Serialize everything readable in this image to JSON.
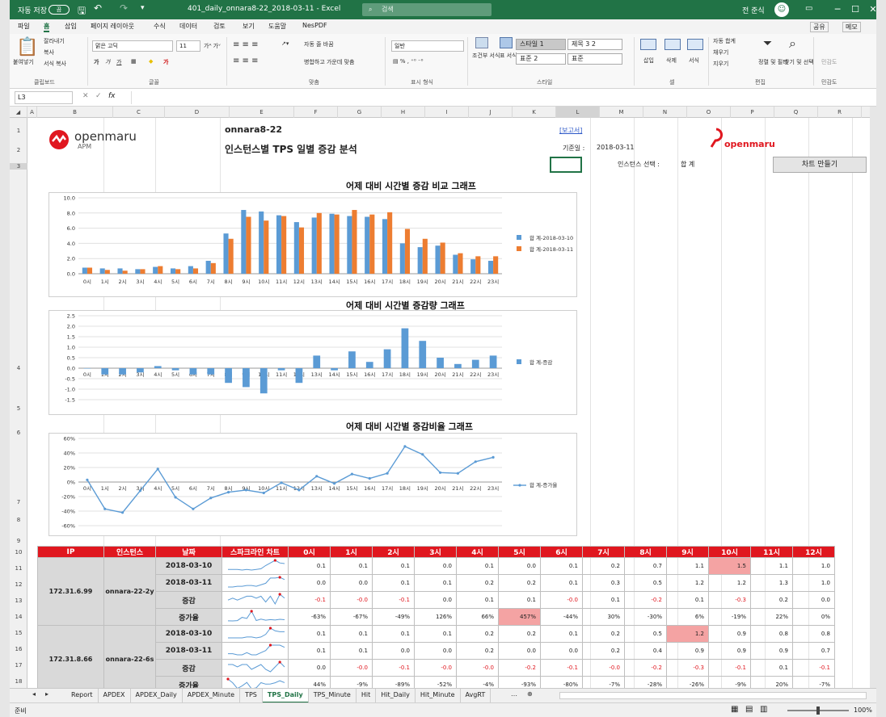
{
  "titlebar": {
    "autosave": "자동 저장",
    "autosave_toggle": "끔",
    "filename": "401_daily_onnara8-22_2018-03-11  -  Excel",
    "search": "검색",
    "user": "전 준식",
    "minimize": "─",
    "maximize": "☐",
    "close": "✕"
  },
  "ribbon_tabs": [
    "파일",
    "홈",
    "삽입",
    "페이지 레이아웃",
    "수식",
    "데이터",
    "검토",
    "보기",
    "도움말",
    "NesPDF"
  ],
  "ribbon_right": {
    "share": "공유",
    "comment": "메모"
  },
  "ribbon": {
    "paste": "붙여넣기",
    "cut": "잘라내기",
    "copy": "복사",
    "format_painter": "서식 복사",
    "clipboard": "클립보드",
    "font_name": "맑은 고딕",
    "font_size": "11",
    "font_group": "글꼴",
    "wrap": "자동 줄 바꿈",
    "merge": "병합하고 가운데 맞춤",
    "align_group": "맞춤",
    "number_format": "일반",
    "number_group": "표시 형식",
    "cond_format": "조건부 서식",
    "table_format": "표 서식",
    "styles": [
      "스타일 1",
      "제목 3 2",
      "표준 2",
      "표준"
    ],
    "style_group": "스타일",
    "insert": "삽입",
    "delete": "삭제",
    "format": "서식",
    "cell_group": "셀",
    "autosum": "자동 합계",
    "fill": "채우기",
    "clear": "지우기",
    "sort": "정렬 및 필터",
    "find": "찾기 및 선택",
    "edit_group": "편집",
    "sensitivity": "민감도",
    "sens_group": "민감도"
  },
  "formula_bar": {
    "cell": "L3",
    "fx": "fx",
    "value": ""
  },
  "columns": [
    "A",
    "B",
    "C",
    "D",
    "E",
    "F",
    "G",
    "H",
    "I",
    "J",
    "K",
    "L",
    "M",
    "N",
    "O",
    "P",
    "Q",
    "R"
  ],
  "rows": [
    "1",
    "2",
    "3",
    "4",
    "5",
    "6",
    "7",
    "8",
    "9",
    "10",
    "11",
    "12",
    "13",
    "14",
    "15",
    "16",
    "17",
    "18"
  ],
  "header": {
    "logo": "openmaru",
    "logo_sub": "APM",
    "instance": "onnara8-22",
    "title": "인스턴스별 TPS 일별 증감 분석",
    "report_link": "[보고서]",
    "date_label": "기준일 :",
    "date": "2018-03-11",
    "select_label": "인스턴스 선택 :",
    "select_value": "합 계",
    "make_chart": "차트 만들기",
    "brand": "openmaru"
  },
  "chart_data": [
    {
      "type": "bar",
      "title": "어제 대비 시간별 증감 비교 그래프",
      "categories": [
        "0시",
        "1시",
        "2시",
        "3시",
        "4시",
        "5시",
        "6시",
        "7시",
        "8시",
        "9시",
        "10시",
        "11시",
        "12시",
        "13시",
        "14시",
        "15시",
        "16시",
        "17시",
        "18시",
        "19시",
        "20시",
        "21시",
        "22시",
        "23시"
      ],
      "ylim": [
        0,
        10
      ],
      "yticks": [
        "0.0",
        "2.0",
        "4.0",
        "6.0",
        "8.0",
        "10.0"
      ],
      "series": [
        {
          "name": "합 계-2018-03-10",
          "color": "#5b9bd5",
          "values": [
            0.8,
            0.7,
            0.7,
            0.6,
            0.9,
            0.7,
            1.0,
            1.7,
            5.3,
            8.4,
            8.2,
            7.7,
            6.8,
            7.4,
            7.9,
            7.6,
            7.5,
            7.2,
            4.0,
            3.5,
            3.7,
            2.5,
            1.9,
            1.7
          ]
        },
        {
          "name": "합 계-2018-03-11",
          "color": "#ed7d31",
          "values": [
            0.8,
            0.5,
            0.4,
            0.6,
            1.0,
            0.6,
            0.7,
            1.4,
            4.6,
            7.5,
            7.0,
            7.6,
            6.1,
            8.0,
            7.8,
            8.4,
            7.8,
            8.1,
            5.9,
            4.6,
            4.1,
            2.7,
            2.3,
            2.3
          ]
        }
      ]
    },
    {
      "type": "bar",
      "title": "어제 대비 시간별 증감량 그래프",
      "categories": [
        "0시",
        "1시",
        "2시",
        "3시",
        "4시",
        "5시",
        "6시",
        "7시",
        "8시",
        "9시",
        "10시",
        "11시",
        "12시",
        "13시",
        "14시",
        "15시",
        "16시",
        "17시",
        "18시",
        "19시",
        "20시",
        "21시",
        "22시",
        "23시"
      ],
      "ylim": [
        -1.5,
        2.5
      ],
      "yticks": [
        "-1.5",
        "-1.0",
        "-0.5",
        "0.0",
        "0.5",
        "1.0",
        "1.5",
        "2.0",
        "2.5"
      ],
      "series": [
        {
          "name": "합 계-증감",
          "color": "#5b9bd5",
          "values": [
            0.0,
            -0.3,
            -0.3,
            -0.2,
            0.1,
            -0.1,
            -0.3,
            -0.3,
            -0.7,
            -0.9,
            -1.2,
            -0.1,
            -0.7,
            0.6,
            -0.1,
            0.8,
            0.3,
            0.9,
            1.9,
            1.3,
            0.5,
            0.2,
            0.4,
            0.6
          ]
        }
      ]
    },
    {
      "type": "line",
      "title": "어제 대비 시간별 증감비율 그래프",
      "categories": [
        "0시",
        "1시",
        "2시",
        "3시",
        "4시",
        "5시",
        "6시",
        "7시",
        "8시",
        "9시",
        "10시",
        "11시",
        "12시",
        "13시",
        "14시",
        "15시",
        "16시",
        "17시",
        "18시",
        "19시",
        "20시",
        "21시",
        "22시",
        "23시"
      ],
      "ylim": [
        -60,
        60
      ],
      "yticks": [
        "-60%",
        "-40%",
        "-20%",
        "0%",
        "20%",
        "40%",
        "60%"
      ],
      "series": [
        {
          "name": "합 계-증가율",
          "color": "#5b9bd5",
          "values": [
            3,
            -37,
            -42,
            -12,
            18,
            -21,
            -37,
            -22,
            -14,
            -11,
            -15,
            -1,
            -11,
            8,
            -2,
            11,
            5,
            12,
            49,
            38,
            13,
            12,
            28,
            34
          ]
        }
      ]
    }
  ],
  "table": {
    "headers": [
      "IP",
      "인스턴스",
      "날짜",
      "스파크라인 차트",
      "0시",
      "1시",
      "2시",
      "3시",
      "4시",
      "5시",
      "6시",
      "7시",
      "8시",
      "9시",
      "10시",
      "11시",
      "12시"
    ],
    "groups": [
      {
        "ip": "172.31.6.99",
        "instance": "onnara-22-2y",
        "rows": [
          {
            "label": "2018-03-10",
            "values": [
              "0.1",
              "0.1",
              "0.1",
              "0.0",
              "0.1",
              "0.0",
              "0.1",
              "0.2",
              "0.7",
              "1.1",
              "1.5",
              "1.1",
              "1.0"
            ]
          },
          {
            "label": "2018-03-11",
            "values": [
              "0.0",
              "0.0",
              "0.1",
              "0.1",
              "0.2",
              "0.2",
              "0.1",
              "0.3",
              "0.5",
              "1.2",
              "1.2",
              "1.3",
              "1.0"
            ]
          },
          {
            "label": "증감",
            "values": [
              "-0.1",
              "-0.0",
              "-0.1",
              "0.0",
              "0.1",
              "0.1",
              "-0.0",
              "0.1",
              "-0.2",
              "0.1",
              "-0.3",
              "0.2",
              "0.0"
            ]
          },
          {
            "label": "증가율",
            "values": [
              "-63%",
              "-67%",
              "-49%",
              "126%",
              "66%",
              "457%",
              "-44%",
              "30%",
              "-30%",
              "6%",
              "-19%",
              "22%",
              "0%"
            ]
          }
        ]
      },
      {
        "ip": "172.31.8.66",
        "instance": "onnara-22-6s",
        "rows": [
          {
            "label": "2018-03-10",
            "values": [
              "0.1",
              "0.1",
              "0.1",
              "0.1",
              "0.2",
              "0.2",
              "0.1",
              "0.2",
              "0.5",
              "1.2",
              "0.9",
              "0.8",
              "0.8"
            ]
          },
          {
            "label": "2018-03-11",
            "values": [
              "0.1",
              "0.1",
              "0.0",
              "0.0",
              "0.2",
              "0.0",
              "0.0",
              "0.2",
              "0.4",
              "0.9",
              "0.9",
              "0.9",
              "0.7"
            ]
          },
          {
            "label": "증감",
            "values": [
              "0.0",
              "-0.0",
              "-0.1",
              "-0.0",
              "-0.0",
              "-0.2",
              "-0.1",
              "-0.0",
              "-0.2",
              "-0.3",
              "-0.1",
              "0.1",
              "-0.1"
            ]
          },
          {
            "label": "증가율",
            "values": [
              "44%",
              "-9%",
              "-89%",
              "-52%",
              "-4%",
              "-93%",
              "-80%",
              "-7%",
              "-28%",
              "-26%",
              "-9%",
              "20%",
              "-7%"
            ]
          }
        ]
      }
    ]
  },
  "sheet_tabs": [
    "Report",
    "APDEX",
    "APDEX_Daily",
    "APDEX_Minute",
    "TPS",
    "TPS_Daily",
    "TPS_Minute",
    "Hit",
    "Hit_Daily",
    "Hit_Minute",
    "AvgRT"
  ],
  "active_tab": "TPS_Daily",
  "status": {
    "ready": "준비",
    "zoom": "100%"
  }
}
